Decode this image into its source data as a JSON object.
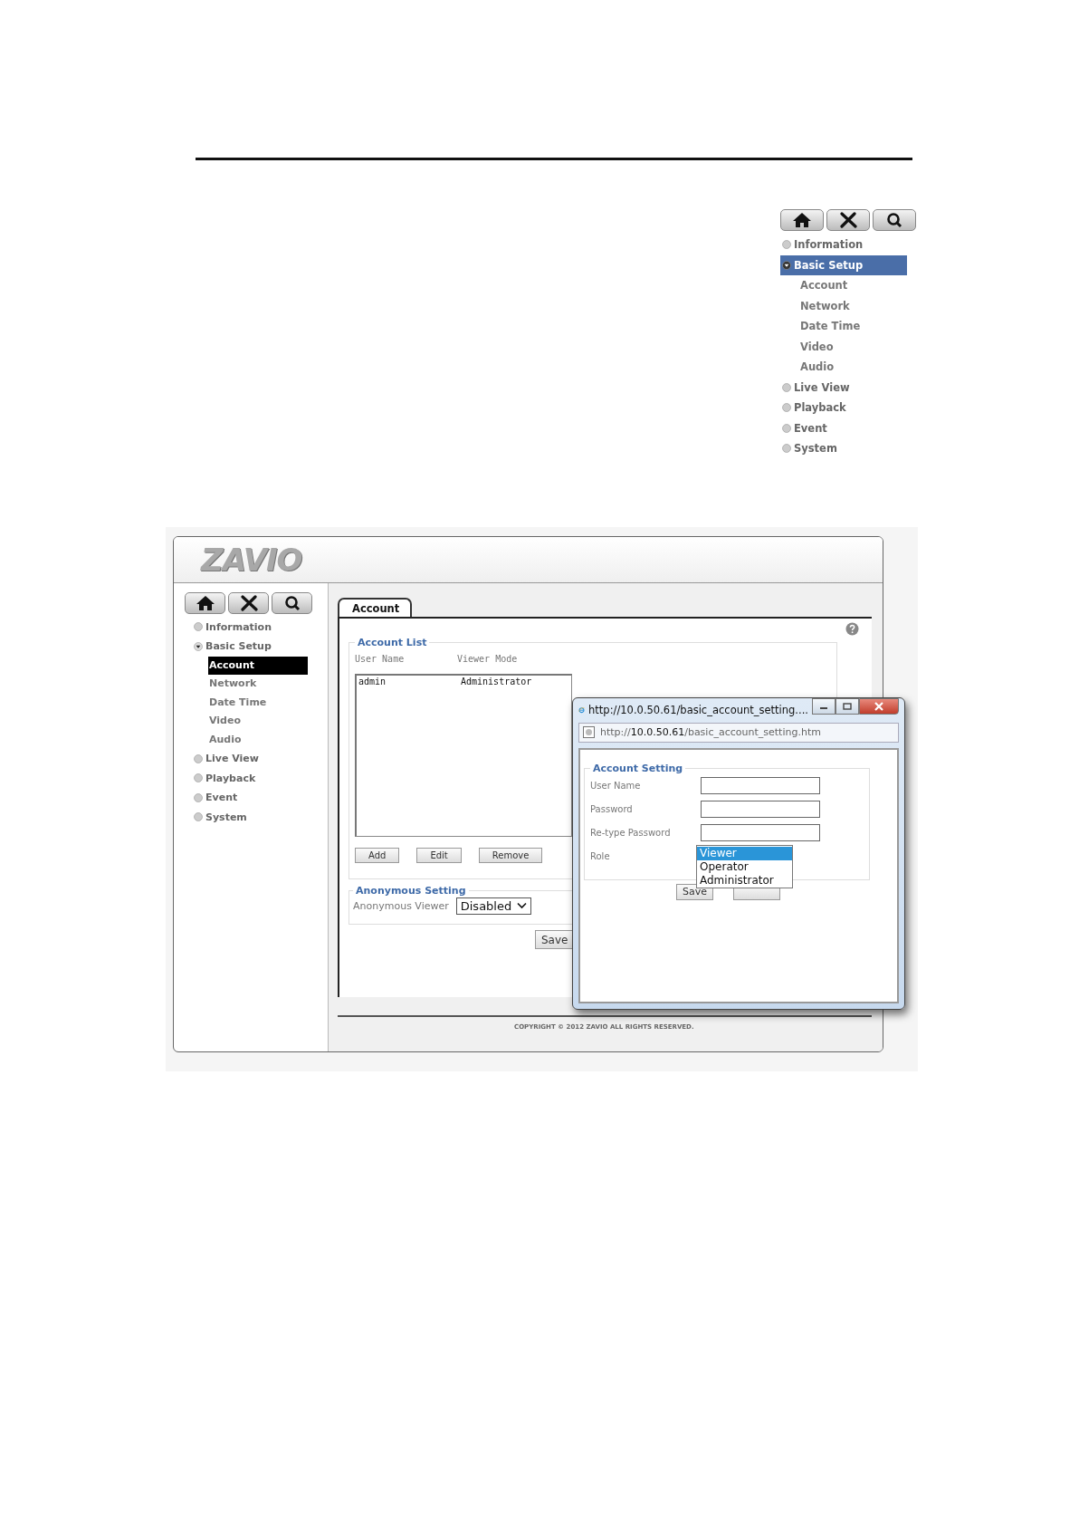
{
  "nav_panel": {
    "menu": [
      {
        "label": "Information",
        "selected": false,
        "expanded": false
      },
      {
        "label": "Basic Setup",
        "selected": true,
        "expanded": true,
        "children": [
          {
            "label": "Account",
            "selected": false
          },
          {
            "label": "Network",
            "selected": false
          },
          {
            "label": "Date Time",
            "selected": false
          },
          {
            "label": "Video",
            "selected": false
          },
          {
            "label": "Audio",
            "selected": false
          }
        ]
      },
      {
        "label": "Live View",
        "selected": false,
        "expanded": false
      },
      {
        "label": "Playback",
        "selected": false,
        "expanded": false
      },
      {
        "label": "Event",
        "selected": false,
        "expanded": false
      },
      {
        "label": "System",
        "selected": false,
        "expanded": false
      }
    ]
  },
  "screenshot": {
    "logo": "ZAVIO",
    "menu": [
      {
        "label": "Information",
        "selected": false,
        "expanded": false
      },
      {
        "label": "Basic Setup",
        "selected": false,
        "expanded": true,
        "children": [
          {
            "label": "Account",
            "selected": true
          },
          {
            "label": "Network",
            "selected": false
          },
          {
            "label": "Date Time",
            "selected": false
          },
          {
            "label": "Video",
            "selected": false
          },
          {
            "label": "Audio",
            "selected": false
          }
        ]
      },
      {
        "label": "Live View",
        "selected": false,
        "expanded": false
      },
      {
        "label": "Playback",
        "selected": false,
        "expanded": false
      },
      {
        "label": "Event",
        "selected": false,
        "expanded": false
      },
      {
        "label": "System",
        "selected": false,
        "expanded": false
      }
    ],
    "tabs": [
      {
        "label": "Account",
        "selected": true
      }
    ],
    "account_list": {
      "title": "Account List",
      "columns": [
        "User Name",
        "Viewer Mode"
      ],
      "rows": [
        [
          "admin",
          "Administrator"
        ]
      ],
      "buttons": [
        "Add",
        "Edit",
        "Remove"
      ]
    },
    "anonymous_setting": {
      "title": "Anonymous Setting",
      "label": "Anonymous Viewer",
      "value": "Disabled"
    },
    "save_button": "Save",
    "copyright": "COPYRIGHT © 2012 ZAVIO ALL RIGHTS RESERVED.",
    "popup": {
      "title": "http://10.0.50.61/basic_account_setting....",
      "address": [
        {
          "text": "http://",
          "strong": false
        },
        {
          "text": "10.0.50.61",
          "strong": true
        },
        {
          "text": "/basic_account_setting.htm",
          "strong": false
        }
      ],
      "section_title": "Account Setting",
      "fields": [
        {
          "label": "User Name"
        },
        {
          "label": "Password"
        },
        {
          "label": "Re-type Password"
        }
      ],
      "role": {
        "label": "Role",
        "options": [
          {
            "label": "Viewer",
            "selected": true
          },
          {
            "label": "Operator",
            "selected": false
          },
          {
            "label": "Administrator",
            "selected": false
          }
        ]
      },
      "save_button": "Save"
    }
  }
}
